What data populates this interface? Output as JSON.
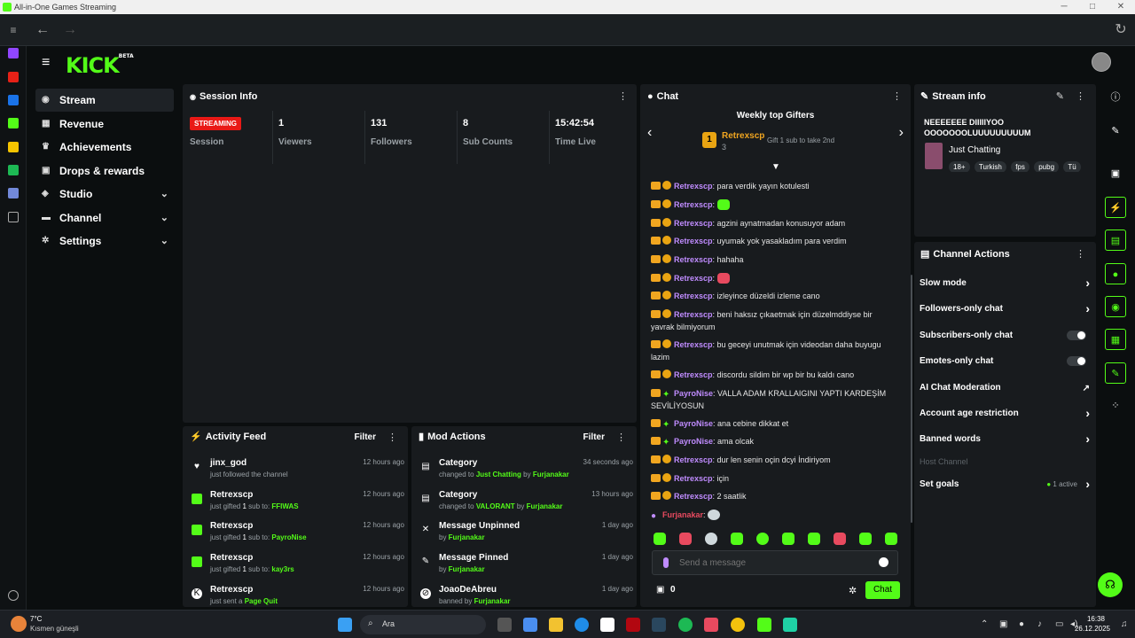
{
  "window": {
    "title": "All-in-One Games Streaming"
  },
  "header": {
    "logo": "KICK",
    "logo_tag": "BETA"
  },
  "sidebar": {
    "items": [
      {
        "label": "Stream"
      },
      {
        "label": "Revenue"
      },
      {
        "label": "Achievements"
      },
      {
        "label": "Drops & rewards"
      },
      {
        "label": "Studio"
      },
      {
        "label": "Channel"
      },
      {
        "label": "Settings"
      }
    ]
  },
  "session": {
    "title": "Session Info",
    "status": "STREAMING",
    "status_label": "Session",
    "stats": [
      {
        "value": "1",
        "label": "Viewers"
      },
      {
        "value": "131",
        "label": "Followers"
      },
      {
        "value": "8",
        "label": "Sub Counts"
      },
      {
        "value": "15:42:54",
        "label": "Time Live"
      }
    ]
  },
  "activity": {
    "title": "Activity Feed",
    "filter": "Filter",
    "items": [
      {
        "name": "jinx_god",
        "desc": "just followed the channel",
        "time": "12 hours ago"
      },
      {
        "name": "Retrexscp",
        "desc_a": "just gifted ",
        "desc_n": "1",
        "desc_b": " sub to: ",
        "desc_t": "FFIWAS",
        "time": "12 hours ago"
      },
      {
        "name": "Retrexscp",
        "desc_a": "just gifted ",
        "desc_n": "1",
        "desc_b": " sub to: ",
        "desc_t": "PayroNise",
        "time": "12 hours ago"
      },
      {
        "name": "Retrexscp",
        "desc_a": "just gifted ",
        "desc_n": "1",
        "desc_b": " sub to: ",
        "desc_t": "kay3rs",
        "time": "12 hours ago"
      },
      {
        "name": "Retrexscp",
        "desc_a": "just sent a ",
        "desc_t": "Page Quit",
        "time": "12 hours ago"
      }
    ]
  },
  "mod": {
    "title": "Mod Actions",
    "filter": "Filter",
    "items": [
      {
        "name": "Category",
        "a": "changed to ",
        "t": "Just Chatting",
        "b": " by ",
        "u": "Furjanakar",
        "time": "34 seconds ago"
      },
      {
        "name": "Category",
        "a": "changed to ",
        "t": "VALORANT",
        "b": " by ",
        "u": "Furjanakar",
        "time": "13 hours ago"
      },
      {
        "name": "Message Unpinned",
        "a": "by ",
        "u": "Furjanakar",
        "time": "1 day ago"
      },
      {
        "name": "Message Pinned",
        "a": "by ",
        "u": "Furjanakar",
        "time": "1 day ago"
      },
      {
        "name": "JoaoDeAbreu",
        "a": "banned by ",
        "u": "Furjanakar",
        "time": "1 day ago"
      }
    ]
  },
  "chat": {
    "title": "Chat",
    "gifters_title": "Weekly top Gifters",
    "top_gifter": "Retrexscp",
    "top_count": "3",
    "gift_hint": "Gift 1 sub to take 2nd",
    "messages": [
      {
        "user": "Retrexscp",
        "text": ": para verdik yayın kotulesti"
      },
      {
        "user": "Retrexscp",
        "text": ":"
      },
      {
        "user": "Retrexscp",
        "text": ": agzini aynatmadan konusuyor adam"
      },
      {
        "user": "Retrexscp",
        "text": ": uyumak yok yasakladım para verdim"
      },
      {
        "user": "Retrexscp",
        "text": ": hahaha"
      },
      {
        "user": "Retrexscp",
        "text": ":"
      },
      {
        "user": "Retrexscp",
        "text": ": izleyince düzeldi izleme cano"
      },
      {
        "user": "Retrexscp",
        "text": ": beni haksız çıkaetmak için düzelmddiyse bir yavrak bilmiyorum"
      },
      {
        "user": "Retrexscp",
        "text": ": bu geceyi unutmak için videodan daha buyugu lazim"
      },
      {
        "user": "Retrexscp",
        "text": ": discordu sildim bir wp bir bu kaldı cano"
      },
      {
        "user": "PayroNise",
        "text": ": VALLA ADAM KRALLAIGINI YAPTI KARDEŞİM SEVİLİYOSUN"
      },
      {
        "user": "PayroNise",
        "text": ": ana cebine dikkat et"
      },
      {
        "user": "PayroNise",
        "text": ": ama olcak"
      },
      {
        "user": "Retrexscp",
        "text": ": dur len senin oçin dcyi İndiriyom"
      },
      {
        "user": "Retrexscp",
        "text": ": için"
      },
      {
        "user": "Retrexscp",
        "text": ": 2 saatlik"
      },
      {
        "user": "Furjanakar",
        "text": ":"
      }
    ],
    "input_placeholder": "Send a message",
    "points": "0",
    "send_label": "Chat"
  },
  "stream_info": {
    "title": "Stream info",
    "stream_title": "NEEEEEEE DIIIIIYOO OOOOOOOLUUUUUUUUUM",
    "category": "Just Chatting",
    "tags": [
      "18+",
      "Turkish",
      "fps",
      "pubg",
      "Tü"
    ]
  },
  "channel_actions": {
    "title": "Channel Actions",
    "items": [
      {
        "label": "Slow mode"
      },
      {
        "label": "Followers-only chat"
      },
      {
        "label": "Subscribers-only chat"
      },
      {
        "label": "Emotes-only chat"
      },
      {
        "label": "AI Chat Moderation"
      },
      {
        "label": "Account age restriction"
      },
      {
        "label": "Banned words"
      },
      {
        "label": "Host Channel"
      },
      {
        "label": "Set goals"
      }
    ],
    "goals_status": "1 active"
  },
  "taskbar": {
    "weather_temp": "7°C",
    "weather_text": "Kısmen güneşli",
    "search": "Ara",
    "time": "16:38",
    "date": "26.12.2025"
  },
  "colors": {
    "accent": "#53fc18",
    "live": "#e91916",
    "username": "#c08cff"
  }
}
